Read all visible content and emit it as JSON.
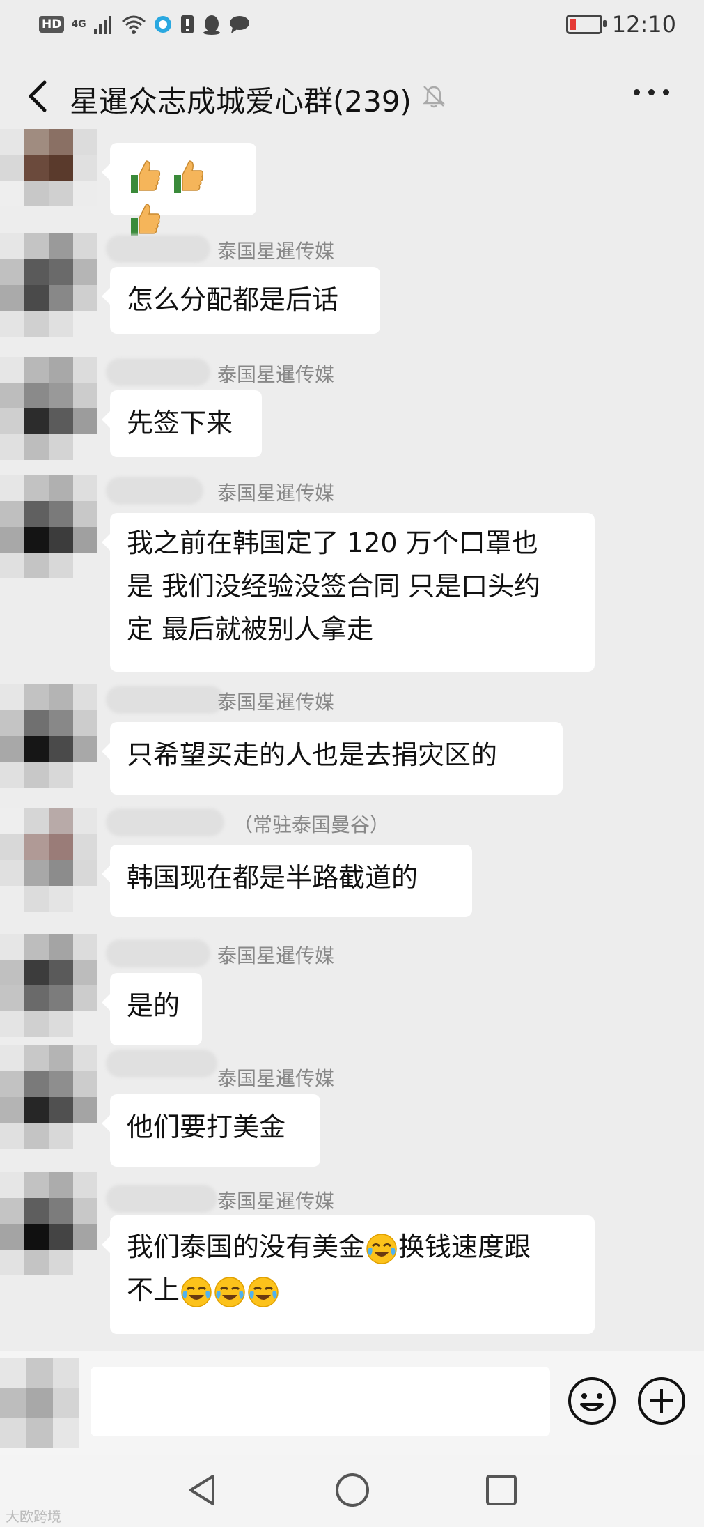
{
  "status_bar": {
    "network_chip": "HD",
    "network_type": "4G",
    "time": "12:10",
    "battery_color": "#e53935"
  },
  "header": {
    "back_icon": "chevron-left-icon",
    "title": "星暹众志成城爱心群(239)",
    "mute_icon": "bell-off-icon",
    "more_icon": "more-dots-icon"
  },
  "messages": [
    {
      "sender": "",
      "text": "",
      "emoji": [
        "thumbs-up",
        "thumbs-up",
        "thumbs-up"
      ]
    },
    {
      "sender": "泰国星暹传媒",
      "text": "怎么分配都是后话"
    },
    {
      "sender": "泰国星暹传媒",
      "text": "先签下来"
    },
    {
      "sender": "泰国星暹传媒",
      "text_lines": [
        "我之前在韩国定了 120 万个口罩也",
        "是 我们没经验没签合同 只是口头约",
        "定 最后就被别人拿走"
      ]
    },
    {
      "sender": "泰国星暹传媒",
      "text": "只希望买走的人也是去捐灾区的"
    },
    {
      "sender": "（常驻泰国曼谷）",
      "text": "韩国现在都是半路截道的"
    },
    {
      "sender": "泰国星暹传媒",
      "text": "是的"
    },
    {
      "sender": "泰国星暹传媒",
      "text": "他们要打美金"
    },
    {
      "sender": "泰国星暹传媒",
      "text_line1_a": "我们泰国的没有美金",
      "text_line1_b": "换钱速度跟",
      "text_line2": "不上",
      "emoji": [
        "crying-laughing"
      ]
    }
  ],
  "input_bar": {
    "placeholder": "",
    "emoji_button_icon": "smiley-icon",
    "plus_button_icon": "plus-icon"
  },
  "nav_bar": {
    "back_icon": "triangle-back-icon",
    "home_icon": "circle-home-icon",
    "recents_icon": "square-recents-icon"
  },
  "watermark": "大欧跨境"
}
